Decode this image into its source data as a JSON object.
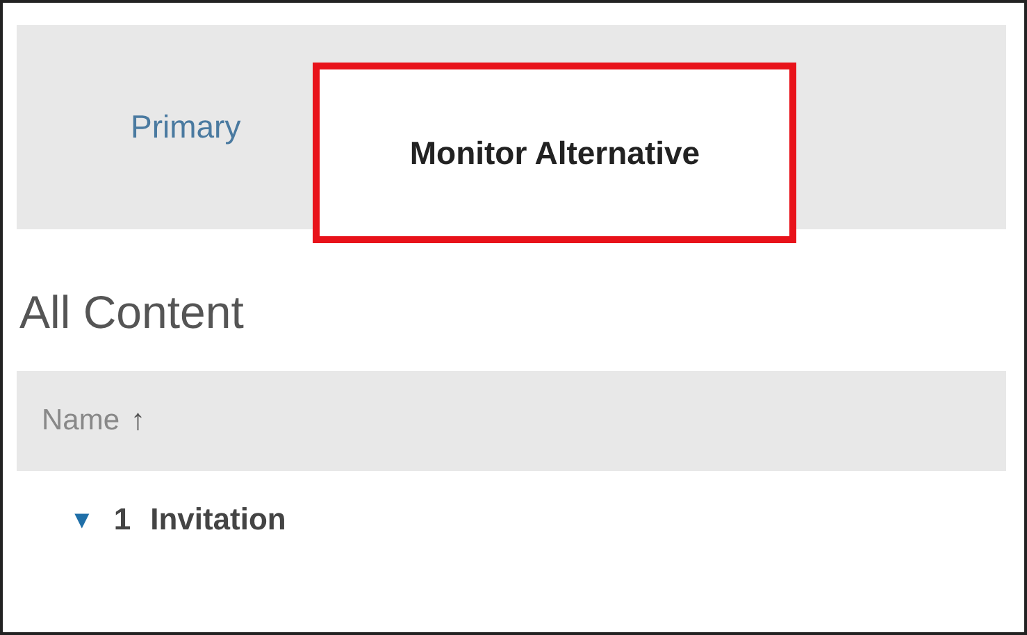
{
  "tabs": [
    {
      "label": "Primary",
      "selected": false,
      "highlighted": false
    },
    {
      "label": "Monitor Alternative",
      "selected": true,
      "highlighted": true
    }
  ],
  "heading": "All Content",
  "table": {
    "columns": [
      {
        "label": "Name",
        "sort": "↑"
      }
    ],
    "rows": [
      {
        "toggle": "▼",
        "expanded": true,
        "number": "1",
        "name": "Invitation"
      }
    ]
  }
}
